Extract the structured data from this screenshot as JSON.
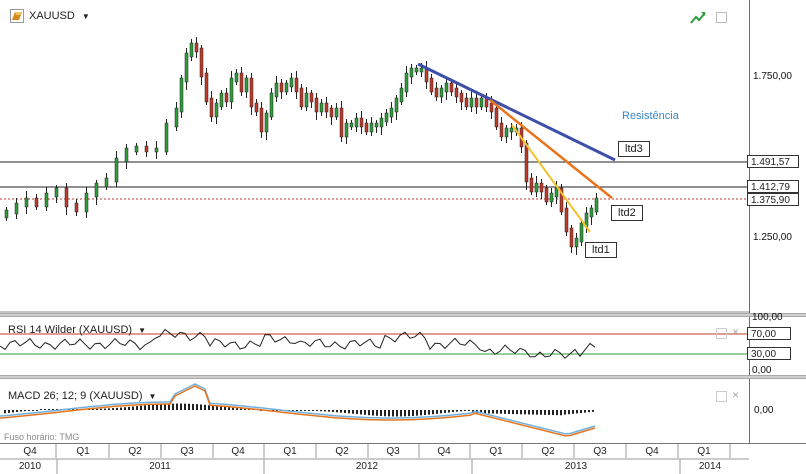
{
  "symbol": {
    "name": "XAUUSD",
    "icon": "gold-bar-icon"
  },
  "toolbar": {
    "trend_icon": "trend-up-icon",
    "window_icon": "restore-icon"
  },
  "price_axis": {
    "ticks": [
      "1.750,00",
      "1.250,00"
    ],
    "markers": [
      "1.491,57",
      "1.412,79",
      "1.375,90"
    ]
  },
  "annotations": {
    "ltd1": "ltd1",
    "ltd2": "ltd2",
    "ltd3": "ltd3",
    "resistance": "Resistência"
  },
  "rsi": {
    "label": "RSI 14 Wilder (XAUUSD)",
    "axis_ticks": [
      "100,00",
      "70,00",
      "30,00",
      "0,00"
    ],
    "levels": [
      70,
      30
    ]
  },
  "macd": {
    "label": "MACD 26; 12; 9 (XAUUSD)",
    "axis_ticks": [
      "0,00"
    ]
  },
  "timezone": "Fuso horário: TMG",
  "time_axis": {
    "quarters": [
      "Q4",
      "Q1",
      "Q2",
      "Q3",
      "Q4",
      "Q1",
      "Q2",
      "Q3",
      "Q4",
      "Q1",
      "Q2",
      "Q3",
      "Q4",
      "Q1"
    ],
    "years": [
      "2010",
      "2011",
      "2012",
      "2013",
      "2014"
    ]
  },
  "colors": {
    "up_candle": "#2e9d3a",
    "down_candle": "#c0392b",
    "ltd1": "#f2c12e",
    "ltd2": "#e8741c",
    "ltd3": "#3d4fa8",
    "rsi_upper": "#c0392b",
    "rsi_lower": "#2e9d3a",
    "macd_line": "#6fb0e0",
    "signal_line": "#e8741c"
  }
}
